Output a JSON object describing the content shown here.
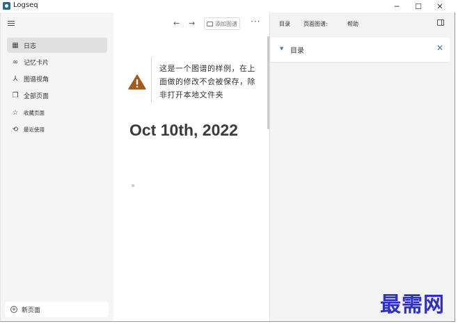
{
  "window": {
    "title": "Logseq",
    "minimize_glyph": "─",
    "maximize_glyph": "☐",
    "close_glyph": "✕"
  },
  "sidebar": {
    "items": [
      {
        "label": "日志",
        "icon": "calendar-icon",
        "glyph": "▦"
      },
      {
        "label": "记忆卡片",
        "icon": "infinity-icon",
        "glyph": "∞"
      },
      {
        "label": "图谱视角",
        "icon": "graph-icon",
        "glyph": "⅄"
      },
      {
        "label": "全部页面",
        "icon": "pages-icon",
        "glyph": "❐"
      },
      {
        "label": "收藏页面",
        "icon": "star-icon",
        "glyph": "☆"
      },
      {
        "label": "最近使用",
        "icon": "history-icon",
        "glyph": "⟲"
      }
    ],
    "new_page_label": "新页面",
    "new_page_glyph": "+"
  },
  "toolbar": {
    "back_glyph": "←",
    "forward_glyph": "→",
    "add_graph_label": "添加图谱",
    "more_glyph": "···"
  },
  "warning": {
    "text": "这是一个图谱的样例，在上面做的修改不会被保存，除非打开本地文件夹"
  },
  "journal": {
    "title": "Oct 10th, 2022"
  },
  "right_panel": {
    "tabs": [
      "目录",
      "页面图谱:",
      "帮助"
    ],
    "toc_label": "目录",
    "toc_arrow_glyph": "▼",
    "close_glyph": "✕"
  },
  "watermark": "最需网",
  "colors": {
    "accent": "#3e7ac2",
    "warning": "#a35a1a",
    "watermark": "#2e2ec8"
  }
}
